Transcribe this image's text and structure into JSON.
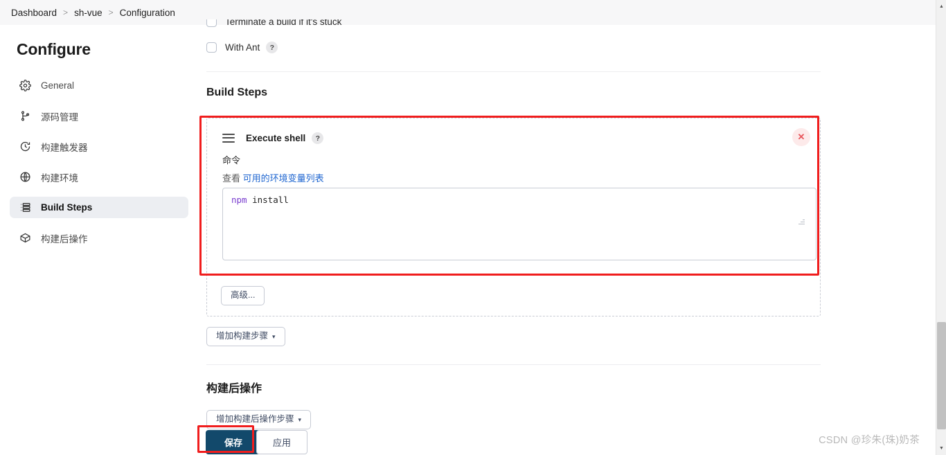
{
  "breadcrumb": {
    "items": [
      "Dashboard",
      "sh-vue",
      "Configuration"
    ],
    "separator": ">"
  },
  "sidebar": {
    "title": "Configure",
    "items": [
      {
        "label": "General",
        "icon": "gear-icon",
        "active": false
      },
      {
        "label": "源码管理",
        "icon": "branch-icon",
        "active": false
      },
      {
        "label": "构建触发器",
        "icon": "clock-icon",
        "active": false
      },
      {
        "label": "构建环境",
        "icon": "globe-icon",
        "active": false
      },
      {
        "label": "Build Steps",
        "icon": "list-icon",
        "active": true
      },
      {
        "label": "构建后操作",
        "icon": "package-icon",
        "active": false
      }
    ]
  },
  "main": {
    "top_checkboxes": [
      {
        "label": "Terminate a build if it's stuck",
        "checked": false,
        "has_help": false
      },
      {
        "label": "With Ant",
        "checked": false,
        "has_help": true,
        "help_label": "?"
      }
    ],
    "build_steps": {
      "heading": "Build Steps",
      "step": {
        "title": "Execute shell",
        "help_label": "?",
        "drag_handle_icon": "hamburger-icon",
        "close_icon": "close-icon",
        "field_label": "命令",
        "env_prefix": "查看",
        "env_link": "可用的环境变量列表",
        "command_keyword": "npm",
        "command_rest": " install",
        "command_value": "npm install"
      },
      "advanced_button": "高级...",
      "add_step_button": "增加构建步骤",
      "add_step_caret": "▾"
    },
    "post_build": {
      "heading": "构建后操作",
      "add_button": "增加构建后操作步骤",
      "add_caret": "▾"
    },
    "actions": {
      "save": "保存",
      "apply": "应用"
    }
  },
  "watermark": "CSDN @珍朱(珠)奶茶",
  "colors": {
    "accent_link": "#1f66d0",
    "save_button": "#12496b",
    "annotation": "#f01d1d",
    "active_nav": "#eceef2"
  }
}
